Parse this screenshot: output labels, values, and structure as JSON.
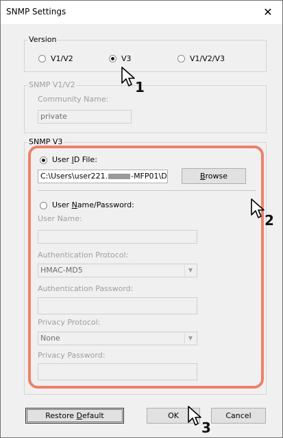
{
  "window": {
    "title": "SNMP Settings",
    "close_glyph": "✕"
  },
  "version": {
    "group_label": "Version",
    "options": [
      {
        "label": "V1/V2",
        "checked": false
      },
      {
        "label": "V3",
        "checked": true
      },
      {
        "label": "V1/V2/V3",
        "checked": false
      }
    ]
  },
  "snmp_v1v2": {
    "group_label": "SNMP V1/V2",
    "community_label": "Community Name:",
    "community_value": "private"
  },
  "snmp_v3": {
    "group_label": "SNMP V3",
    "user_id_file_label_pre": "User ",
    "user_id_file_label_ul": "I",
    "user_id_file_label_post": "D File:",
    "user_id_file_checked": true,
    "file_path": "C:\\Users\\user221.",
    "file_path_tail": "-MFP01\\D",
    "browse_pre": "",
    "browse_ul": "B",
    "browse_post": "rowse",
    "username_password_pre": "User ",
    "username_password_ul": "N",
    "username_password_post": "ame/Password:",
    "username_password_checked": false,
    "user_name_label": "User Name:",
    "user_name_value": "",
    "auth_protocol_label": "Authentication Protocol:",
    "auth_protocol_value": "HMAC-MD5",
    "auth_password_label": "Authentication Password:",
    "auth_password_value": "",
    "privacy_protocol_label": "Privacy Protocol:",
    "privacy_protocol_value": "None",
    "privacy_password_label": "Privacy Password:",
    "privacy_password_value": ""
  },
  "footer": {
    "restore_pre": "Restore ",
    "restore_ul": "D",
    "restore_post": "efault",
    "ok_label": "OK",
    "cancel_label": "Cancel"
  },
  "annotations": {
    "step1": "1",
    "step2": "2",
    "step3": "3",
    "callout_color": "#ee8069"
  }
}
